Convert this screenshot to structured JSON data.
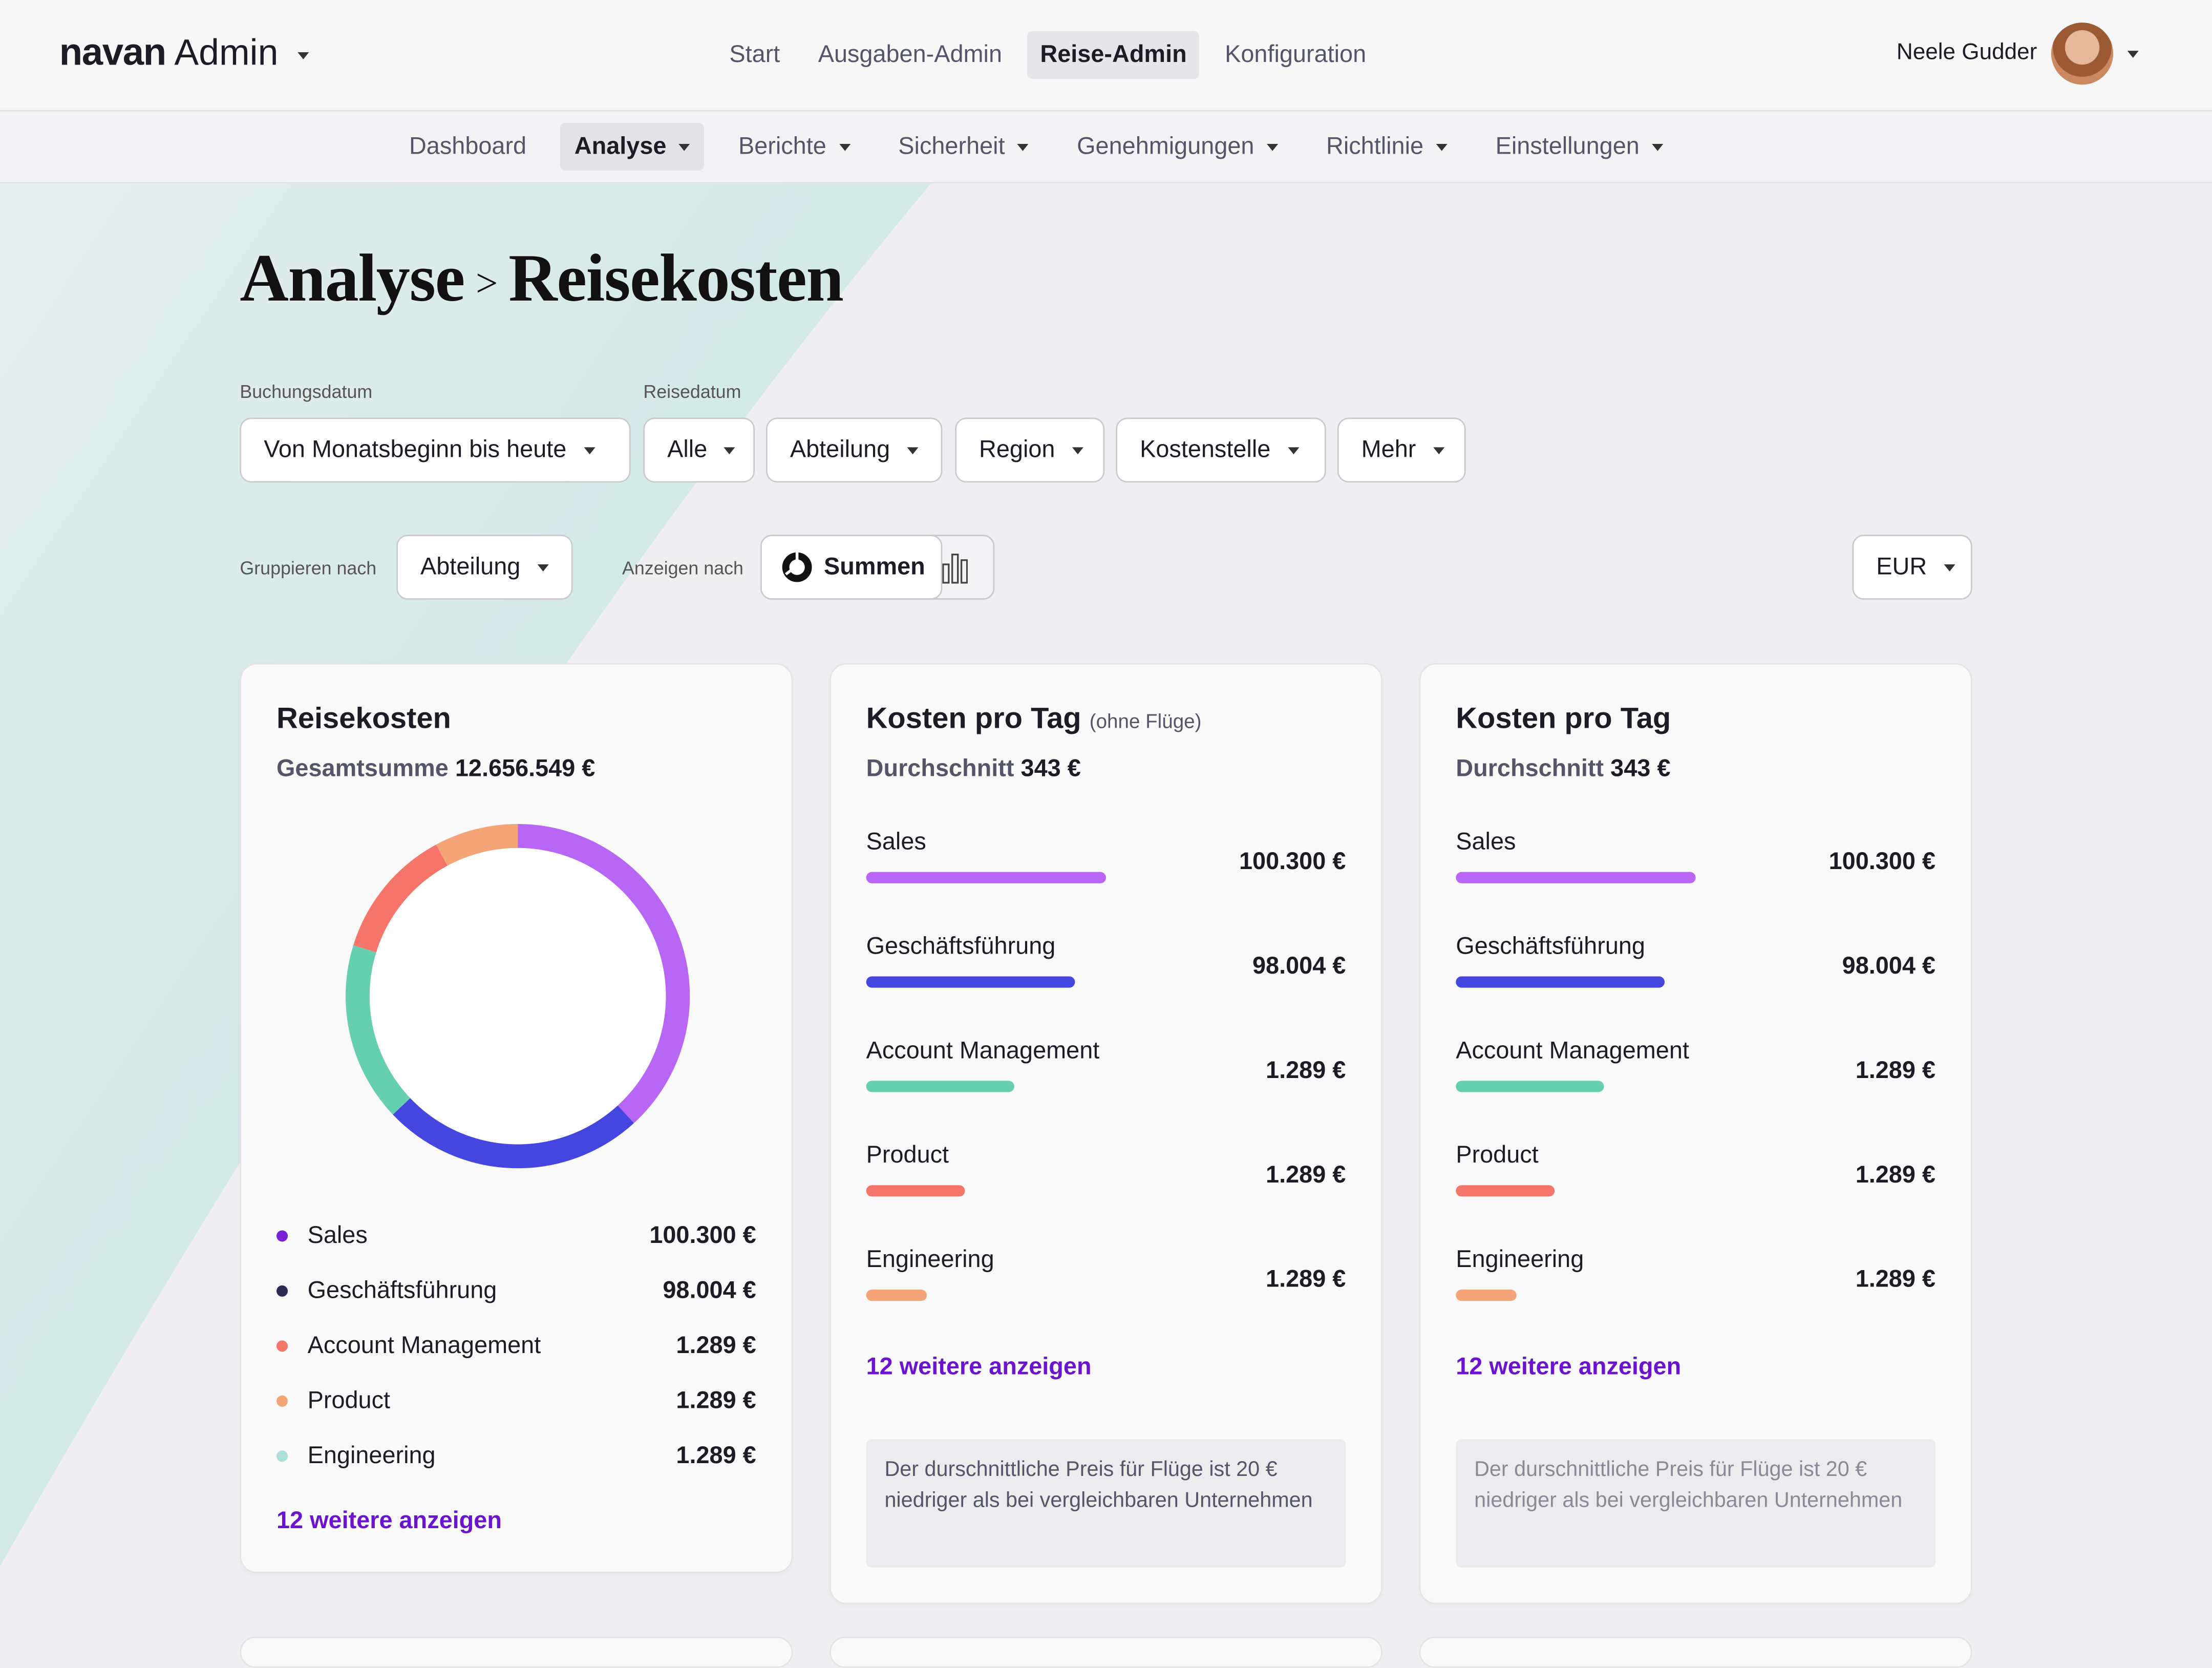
{
  "app": {
    "brand": "navan",
    "product": "Admin"
  },
  "top_nav": [
    {
      "label": "Start",
      "active": false
    },
    {
      "label": "Ausgaben-Admin",
      "active": false
    },
    {
      "label": "Reise-Admin",
      "active": true
    },
    {
      "label": "Konfiguration",
      "active": false
    }
  ],
  "user": {
    "name": "Neele Gudder"
  },
  "sub_nav": [
    {
      "label": "Dashboard",
      "active": false,
      "dropdown": false
    },
    {
      "label": "Analyse",
      "active": true,
      "dropdown": true
    },
    {
      "label": "Berichte",
      "active": false,
      "dropdown": true
    },
    {
      "label": "Sicherheit",
      "active": false,
      "dropdown": true
    },
    {
      "label": "Genehmigungen",
      "active": false,
      "dropdown": true
    },
    {
      "label": "Richtlinie",
      "active": false,
      "dropdown": true
    },
    {
      "label": "Einstellungen",
      "active": false,
      "dropdown": true
    }
  ],
  "page": {
    "section": "Analyse",
    "separator": ">",
    "title": "Reisekosten"
  },
  "filters": {
    "booking_date_label": "Buchungsdatum",
    "booking_date_value": "Von Monatsbeginn bis heute",
    "travel_date_label": "Reisedatum",
    "travel_date_value": "Alle",
    "department": "Abteilung",
    "region": "Region",
    "cost_center": "Kostenstelle",
    "more": "Mehr"
  },
  "controls": {
    "group_by_label": "Gruppieren nach",
    "group_by_value": "Abteilung",
    "display_by_label": "Anzeigen nach",
    "display_totals": "Summen",
    "currency": "EUR"
  },
  "colors": {
    "sales": "#b866f5",
    "management": "#4545e0",
    "account": "#65cfb0",
    "product": "#f6756a",
    "engineering": "#f4a476",
    "link": "#6a14d0"
  },
  "card1": {
    "title": "Reisekosten",
    "total_label": "Gesamtsumme",
    "total_value": "12.656.549 €",
    "legend": [
      {
        "label": "Sales",
        "value": "100.300 €",
        "dot": "#7a1fd6"
      },
      {
        "label": "Geschäftsführung",
        "value": "98.004 €",
        "dot": "#2b2b55"
      },
      {
        "label": "Account Management",
        "value": "1.289 €",
        "dot": "#f6756a"
      },
      {
        "label": "Product",
        "value": "1.289 €",
        "dot": "#f4a476"
      },
      {
        "label": "Engineering",
        "value": "1.289 €",
        "dot": "#a9ded9"
      }
    ],
    "more_link": "12 weitere anzeigen"
  },
  "chart_data": {
    "type": "pie",
    "variant": "donut",
    "categories": [
      "Sales",
      "Geschäftsführung",
      "Account Management",
      "Product",
      "Engineering"
    ],
    "values": [
      34,
      22,
      15,
      11,
      7
    ],
    "colors": [
      "#b866f5",
      "#4545e0",
      "#65cfb0",
      "#f6756a",
      "#f4a476"
    ]
  },
  "card2": {
    "title": "Kosten pro Tag",
    "title_note": "(ohne Flüge)",
    "avg_label": "Durchschnitt",
    "avg_value": "343 €",
    "rows": [
      {
        "label": "Sales",
        "value": "100.300 €",
        "fraction": 0.5,
        "color": "#b866f5"
      },
      {
        "label": "Geschäftsführung",
        "value": "98.004 €",
        "fraction": 0.435,
        "color": "#4545e0"
      },
      {
        "label": "Account Management",
        "value": "1.289 €",
        "fraction": 0.31,
        "color": "#65cfb0"
      },
      {
        "label": "Product",
        "value": "1.289 €",
        "fraction": 0.205,
        "color": "#f6756a"
      },
      {
        "label": "Engineering",
        "value": "1.289 €",
        "fraction": 0.125,
        "color": "#f4a476"
      }
    ],
    "more_link": "12 weitere anzeigen",
    "note": "Der durschnittliche Preis für Flüge ist 20 € niedriger als bei vergleichbaren Unternehmen"
  },
  "card3": {
    "title": "Kosten pro Tag",
    "avg_label": "Durchschnitt",
    "avg_value": "343 €",
    "rows": [
      {
        "label": "Sales",
        "value": "100.300 €",
        "fraction": 0.5,
        "color": "#b866f5"
      },
      {
        "label": "Geschäftsführung",
        "value": "98.004 €",
        "fraction": 0.435,
        "color": "#4545e0"
      },
      {
        "label": "Account Management",
        "value": "1.289 €",
        "fraction": 0.31,
        "color": "#65cfb0"
      },
      {
        "label": "Product",
        "value": "1.289 €",
        "fraction": 0.205,
        "color": "#f6756a"
      },
      {
        "label": "Engineering",
        "value": "1.289 €",
        "fraction": 0.125,
        "color": "#f4a476"
      }
    ],
    "more_link": "12 weitere anzeigen",
    "note": "Der durschnittliche Preis für Flüge ist 20 € niedriger als bei vergleichbaren Unternehmen"
  }
}
